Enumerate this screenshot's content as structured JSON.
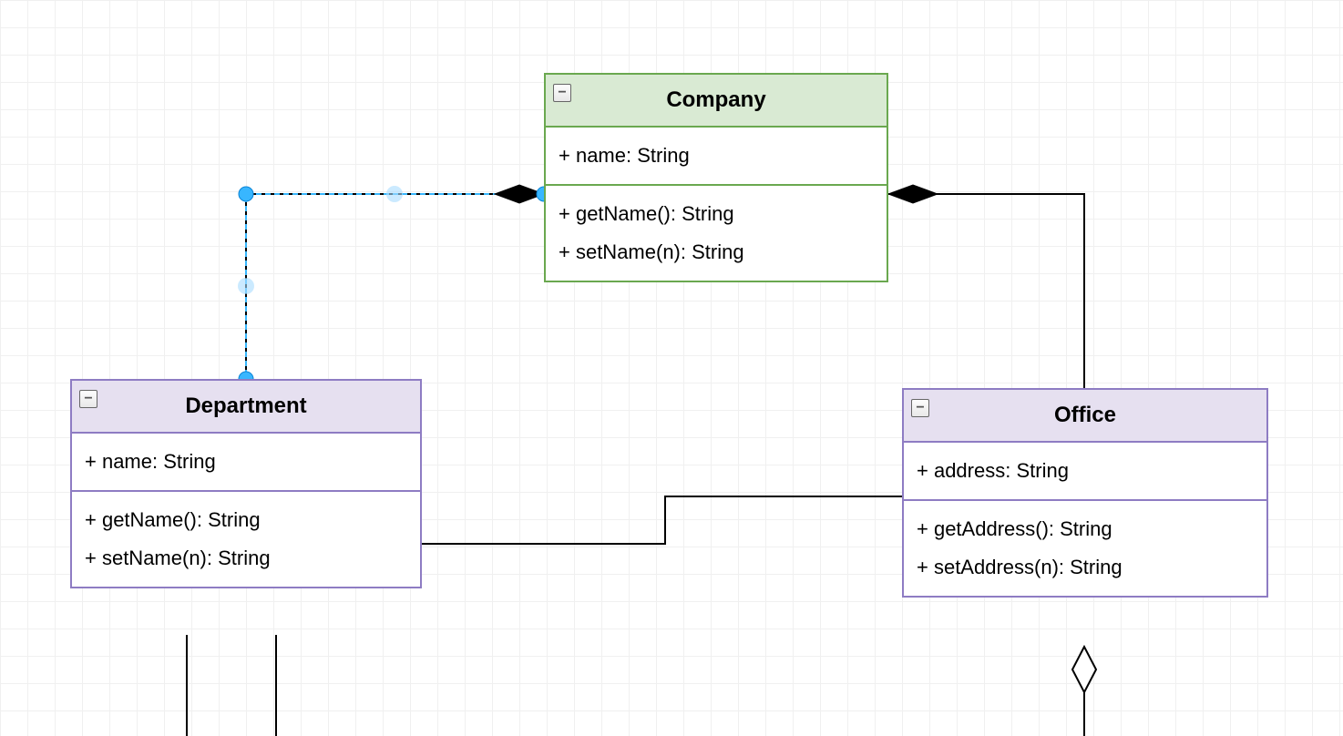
{
  "classes": {
    "company": {
      "name": "Company",
      "attributes": [
        "+ name: String"
      ],
      "methods": [
        "+ getName(): String",
        "+ setName(n): String"
      ]
    },
    "department": {
      "name": "Department",
      "attributes": [
        "+ name: String"
      ],
      "methods": [
        "+ getName(): String",
        "+ setName(n): String"
      ]
    },
    "office": {
      "name": "Office",
      "attributes": [
        "+ address: String"
      ],
      "methods": [
        "+ getAddress(): String",
        "+ setAddress(n): String"
      ]
    }
  },
  "collapse_glyph": "−",
  "chart_data": {
    "type": "uml_class_diagram",
    "classes": [
      {
        "id": "Company",
        "color": "green",
        "attributes": [
          {
            "visibility": "+",
            "name": "name",
            "type": "String"
          }
        ],
        "methods": [
          {
            "visibility": "+",
            "name": "getName",
            "params": "",
            "return": "String"
          },
          {
            "visibility": "+",
            "name": "setName",
            "params": "n",
            "return": "String"
          }
        ]
      },
      {
        "id": "Department",
        "color": "purple",
        "attributes": [
          {
            "visibility": "+",
            "name": "name",
            "type": "String"
          }
        ],
        "methods": [
          {
            "visibility": "+",
            "name": "getName",
            "params": "",
            "return": "String"
          },
          {
            "visibility": "+",
            "name": "setName",
            "params": "n",
            "return": "String"
          }
        ]
      },
      {
        "id": "Office",
        "color": "purple",
        "attributes": [
          {
            "visibility": "+",
            "name": "address",
            "type": "String"
          }
        ],
        "methods": [
          {
            "visibility": "+",
            "name": "getAddress",
            "params": "",
            "return": "String"
          },
          {
            "visibility": "+",
            "name": "setAddress",
            "params": "n",
            "return": "String"
          }
        ]
      }
    ],
    "relationships": [
      {
        "from": "Company",
        "to": "Department",
        "type": "composition",
        "selected": true
      },
      {
        "from": "Company",
        "to": "Office",
        "type": "composition"
      },
      {
        "from": "Department",
        "to": "Office",
        "type": "association"
      },
      {
        "from": "Department",
        "to": "below",
        "type": "association_partial"
      },
      {
        "from": "Office",
        "to": "below",
        "type": "aggregation_partial"
      }
    ]
  }
}
